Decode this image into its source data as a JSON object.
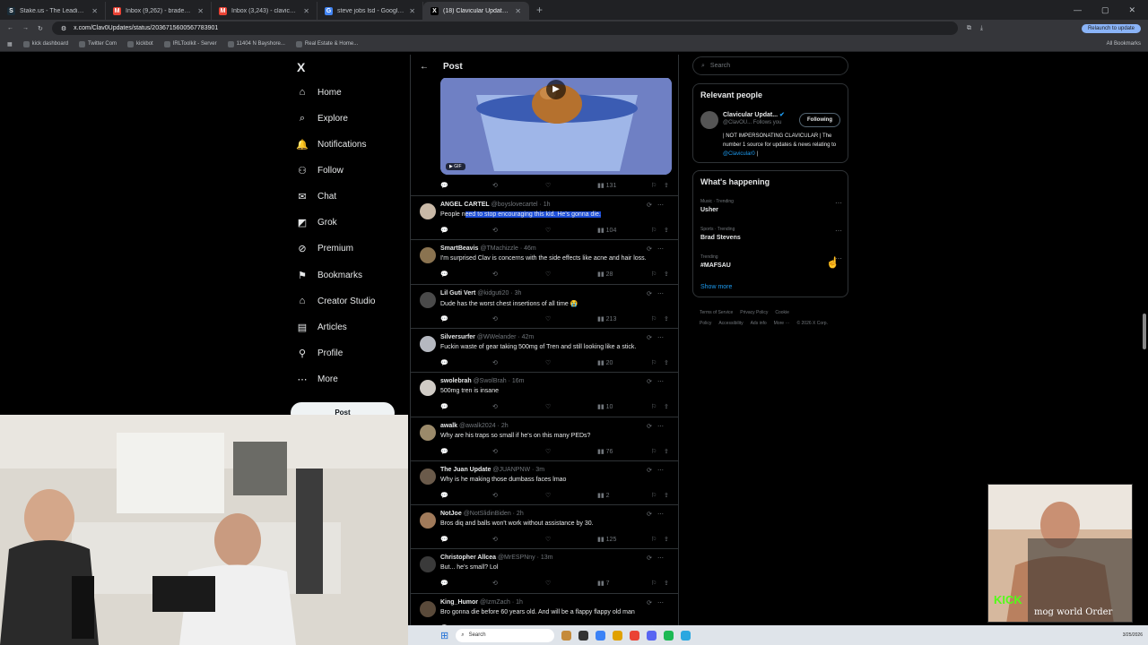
{
  "browser": {
    "tabs": [
      {
        "icon": "S",
        "title": "Stake.us - The Leading Social C",
        "color": "#1a2c38"
      },
      {
        "icon": "M",
        "title": "Inbox (9,262) - bradenabc@gm",
        "color": "#ea4335"
      },
      {
        "icon": "M",
        "title": "Inbox (3,243) - clavicularalt@g",
        "color": "#ea4335"
      },
      {
        "icon": "G",
        "title": "steve jobs lsd - Google Search",
        "color": "#4285f4"
      },
      {
        "icon": "X",
        "title": "(18) Clavicular Updates on",
        "color": "#000000"
      }
    ],
    "url": "x.com/Clav0Updates/status/2036715600567783901",
    "relaunch": "Relaunch to update",
    "bookmarks": [
      "kick dashboard",
      "Twitter Com",
      "kickbot",
      "IRLToolkit - Server",
      "11404 N Bayshore...",
      "Real Estate & Home..."
    ],
    "all_bookmarks": "All Bookmarks"
  },
  "nav": {
    "logo": "X",
    "items": [
      {
        "label": "Home",
        "icon": "⌂"
      },
      {
        "label": "Explore",
        "icon": "⌕"
      },
      {
        "label": "Notifications",
        "icon": "🔔"
      },
      {
        "label": "Follow",
        "icon": "⚇"
      },
      {
        "label": "Chat",
        "icon": "✉"
      },
      {
        "label": "Grok",
        "icon": "◩"
      },
      {
        "label": "Premium",
        "icon": "⊘"
      },
      {
        "label": "Bookmarks",
        "icon": "⚑"
      },
      {
        "label": "Creator Studio",
        "icon": "⌂"
      },
      {
        "label": "Articles",
        "icon": "▤"
      },
      {
        "label": "Profile",
        "icon": "⚲"
      },
      {
        "label": "More",
        "icon": "⋯"
      }
    ],
    "post_button": "Post"
  },
  "feed": {
    "header": "Post",
    "gif_badge": "GIF",
    "first_actions": {
      "views": "131"
    },
    "replies": [
      {
        "name": "ANGEL CARTEL",
        "handle": "@boyslovecartel · 1h",
        "pre": "People n",
        "highlight": "eed to stop encouraging this kid. He's gonna die.",
        "text": "",
        "views": "104",
        "avatar": "#c9b9a7"
      },
      {
        "name": "SmartBeavis",
        "handle": "@TMachizzle · 46m",
        "pre": "",
        "highlight": "",
        "text": "I'm surprised Clav is concerns with the side effects like acne and hair loss.",
        "views": "28",
        "avatar": "#8a7350"
      },
      {
        "name": "Lil Guti Vert",
        "handle": "@kidguti20 · 3h",
        "pre": "",
        "highlight": "",
        "text": "Dude has the worst chest insertions of all time 😭",
        "views": "213",
        "avatar": "#4a4a4a"
      },
      {
        "name": "Silversurfer",
        "handle": "@WWelander · 42m",
        "pre": "",
        "highlight": "",
        "text": "Fuckin waste of gear taking 500mg of Tren and still looking like a stick.",
        "views": "20",
        "avatar": "#b5b8c0"
      },
      {
        "name": "swolebrah",
        "handle": "@SwolBrah · 16m",
        "pre": "",
        "highlight": "",
        "text": "500mg tren is insane",
        "views": "10",
        "avatar": "#d0cbc5"
      },
      {
        "name": "awalk",
        "handle": "@awalk2024 · 2h",
        "pre": "",
        "highlight": "",
        "text": "Why are his traps so small if he's on this many PEDs?",
        "views": "76",
        "avatar": "#9b8a6a"
      },
      {
        "name": "The Juan Update",
        "handle": "@JUANPNW · 3m",
        "pre": "",
        "highlight": "",
        "text": "Why is he making those dumbass faces lmao",
        "views": "2",
        "avatar": "#6a5a4a"
      },
      {
        "name": "NotJoe",
        "handle": "@NotSlidinBiden · 2h",
        "pre": "",
        "highlight": "",
        "text": "Bros diq and balls won't work without assistance by 30.",
        "views": "125",
        "avatar": "#a07a5a"
      },
      {
        "name": "Christopher Allcea",
        "handle": "@MrESPNny · 13m",
        "pre": "",
        "highlight": "",
        "text": "But... he's small? Lol",
        "views": "7",
        "avatar": "#3a3a3a"
      },
      {
        "name": "King_Humor",
        "handle": "@IzmZach · 1h",
        "pre": "",
        "highlight": "",
        "text": "Bro gonna die before 60 years old. And will be a flappy flappy old man",
        "views": "",
        "avatar": "#5a4a3a"
      }
    ]
  },
  "sidebar": {
    "search_placeholder": "Search",
    "relevant_title": "Relevant people",
    "person": {
      "name": "Clavicular Updat...",
      "handle": "@ClavOU...  Follows you",
      "follow": "Following",
      "bio_pre": "| NOT IMPERSONATING CLAVICULAR | The number 1 source for updates & news relating to ",
      "bio_mention": "@Clavicular0",
      "bio_post": " |"
    },
    "whats_happening": "What's happening",
    "trends": [
      {
        "category": "Music · Trending",
        "name": "Usher"
      },
      {
        "category": "Sports · Trending",
        "name": "Brad Stevens"
      },
      {
        "category": "Trending",
        "name": "#MAFSAU"
      }
    ],
    "show_more": "Show more",
    "footer": [
      "Terms of Service",
      "Privacy Policy",
      "Cookie Policy",
      "Accessibility",
      "Ads info",
      "More ···",
      "© 2026 X Corp."
    ]
  },
  "stream": {
    "kick_label": "KICK",
    "overlay_text": "mog world Order"
  },
  "taskbar": {
    "search": "Search",
    "time": "",
    "date": "3/25/2026"
  }
}
